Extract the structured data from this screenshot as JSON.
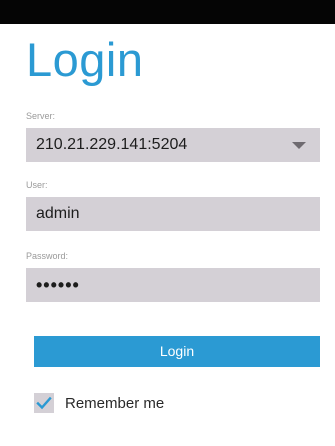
{
  "page": {
    "title": "Login"
  },
  "form": {
    "server": {
      "label": "Server:",
      "value": "210.21.229.141:5204"
    },
    "user": {
      "label": "User:",
      "value": "admin"
    },
    "password": {
      "label": "Password:",
      "value": "••••••"
    },
    "login_button": "Login",
    "remember": {
      "label": "Remember me",
      "checked": true
    }
  },
  "colors": {
    "accent": "#2b9ad3",
    "field_background": "#d4d0d6",
    "status_bar": "#050505"
  },
  "icons": {
    "dropdown": "chevron-down-icon",
    "check": "checkmark-icon"
  }
}
